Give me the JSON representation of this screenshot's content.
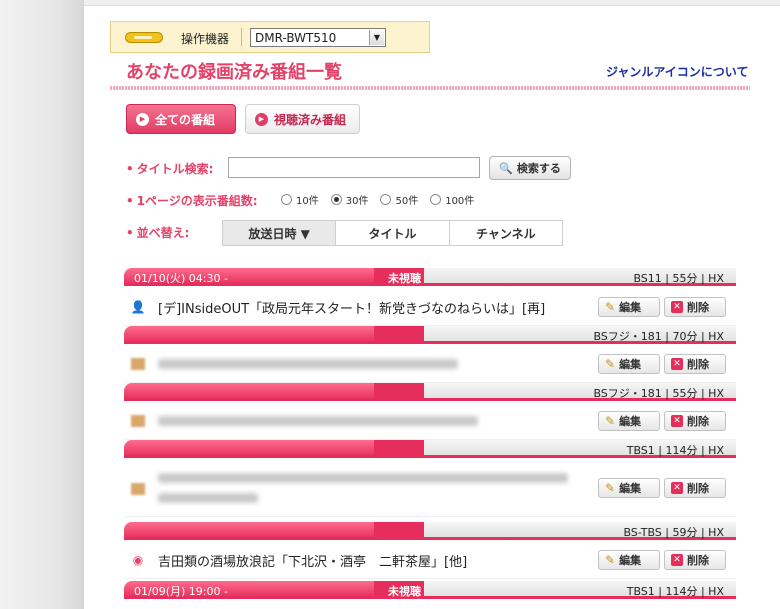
{
  "device": {
    "label": "操作機器",
    "selected": "DMR-BWT510"
  },
  "page": {
    "title": "あなたの録画済み番組一覧",
    "genre_link": "ジャンルアイコンについて"
  },
  "filter_buttons": {
    "all": "全ての番組",
    "watched": "視聴済み番組"
  },
  "search": {
    "label": "タイトル検索:",
    "value": "",
    "button": "検索する"
  },
  "per_page": {
    "label": "1ページの表示番組数:",
    "options": [
      "10件",
      "30件",
      "50件",
      "100件"
    ],
    "selected": "30件"
  },
  "sort": {
    "label": "並べ替え:",
    "tabs": [
      "放送日時 ▼",
      "タイトル",
      "チャンネル"
    ],
    "active": "放送日時 ▼"
  },
  "actions": {
    "edit": "編集",
    "delete": "削除"
  },
  "recordings": [
    {
      "date": "01/10(火) 04:30 -",
      "status": "未視聴",
      "meta": "BS11 | 55分 | HX",
      "title": "[デ]INsideOUT「政局元年スタート！新党きづなのねらいは」[再]",
      "icon": "person-icon",
      "blurred": false
    },
    {
      "date": "",
      "status": "",
      "meta": "BSフジ・181 | 70分 | HX",
      "title": "",
      "icon": "food-icon",
      "blurred": true
    },
    {
      "date": "",
      "status": "",
      "meta": "BSフジ・181 | 55分 | HX",
      "title": "",
      "icon": "food-icon",
      "blurred": true
    },
    {
      "date": "",
      "status": "",
      "meta": "TBS1 | 114分 | HX",
      "title": "",
      "icon": "food-icon",
      "blurred": true
    },
    {
      "date": "",
      "status": "",
      "meta": "BS-TBS | 59分 | HX",
      "title": "吉田類の酒場放浪記「下北沢・酒亭　二軒茶屋」[他]",
      "icon": "music-icon",
      "blurred": false
    },
    {
      "date": "01/09(月) 19:00 -",
      "status": "未視聴",
      "meta": "TBS1 | 114分 | HX",
      "title": "",
      "icon": "",
      "blurred": false
    }
  ],
  "colors": {
    "accent": "#e5426a",
    "link": "#1a2ea8",
    "device_bar": "#fdf3cf"
  }
}
